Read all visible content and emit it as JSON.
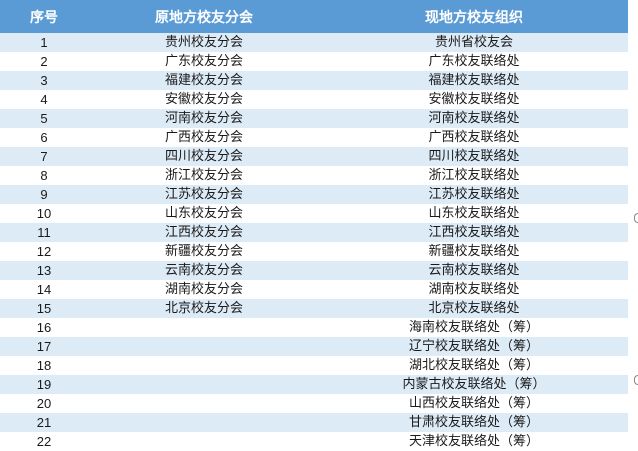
{
  "table": {
    "headers": [
      "序号",
      "原地方校友分会",
      "现地方校友组织"
    ],
    "rows": [
      [
        "1",
        "贵州校友分会",
        "贵州省校友会"
      ],
      [
        "2",
        "广东校友分会",
        "广东校友联络处"
      ],
      [
        "3",
        "福建校友分会",
        "福建校友联络处"
      ],
      [
        "4",
        "安徽校友分会",
        "安徽校友联络处"
      ],
      [
        "5",
        "河南校友分会",
        "河南校友联络处"
      ],
      [
        "6",
        "广西校友分会",
        "广西校友联络处"
      ],
      [
        "7",
        "四川校友分会",
        "四川校友联络处"
      ],
      [
        "8",
        "浙江校友分会",
        "浙江校友联络处"
      ],
      [
        "9",
        "江苏校友分会",
        "江苏校友联络处"
      ],
      [
        "10",
        "山东校友分会",
        "山东校友联络处"
      ],
      [
        "11",
        "江西校友分会",
        "江西校友联络处"
      ],
      [
        "12",
        "新疆校友分会",
        "新疆校友联络处"
      ],
      [
        "13",
        "云南校友分会",
        "云南校友联络处"
      ],
      [
        "14",
        "湖南校友分会",
        "湖南校友联络处"
      ],
      [
        "15",
        "北京校友分会",
        "北京校友联络处"
      ],
      [
        "16",
        "",
        "海南校友联络处（筹）"
      ],
      [
        "17",
        "",
        "辽宁校友联络处（筹）"
      ],
      [
        "18",
        "",
        "湖北校友联络处（筹）"
      ],
      [
        "19",
        "",
        "内蒙古校友联络处（筹）"
      ],
      [
        "20",
        "",
        "山西校友联络处（筹）"
      ],
      [
        "21",
        "",
        "甘肃校友联络处（筹）"
      ],
      [
        "22",
        "",
        "天津校友联络处（筹）"
      ]
    ]
  },
  "colors": {
    "header_bg": "#5b9bd5",
    "band_bg": "#ddebf7",
    "row_bg": "#ffffff"
  }
}
